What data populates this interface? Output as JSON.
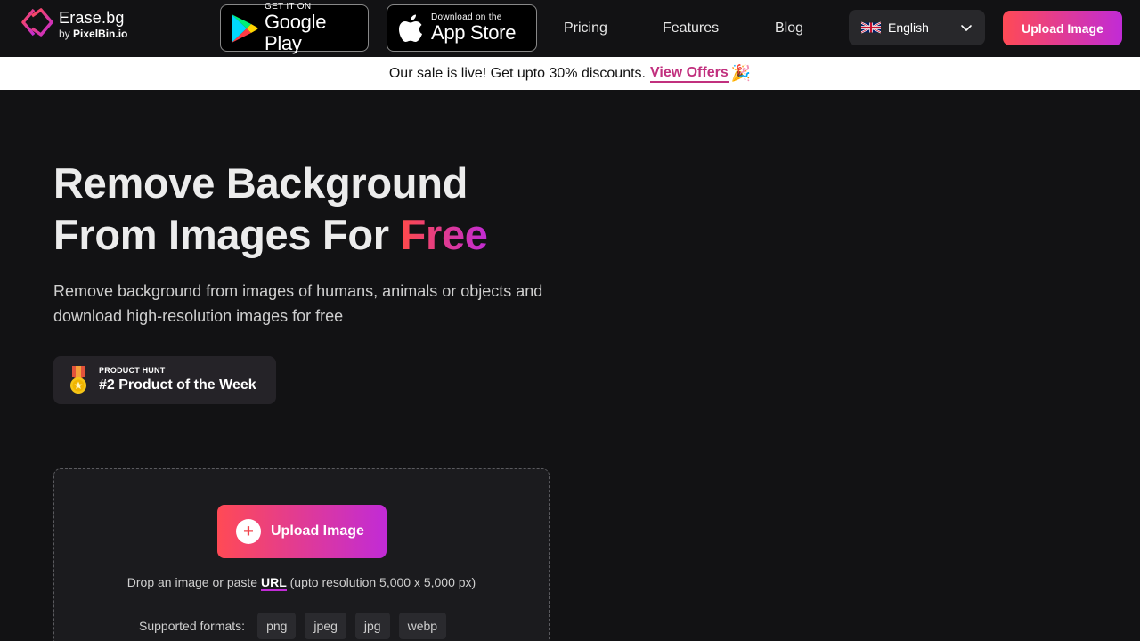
{
  "header": {
    "logo": {
      "name": "Erase.bg",
      "by_prefix": "by",
      "by_brand": "PixelBin.io"
    },
    "google_play": {
      "small": "GET IT ON",
      "big": "Google Play"
    },
    "app_store": {
      "small": "Download on the",
      "big": "App Store"
    },
    "nav": [
      "Pricing",
      "Features",
      "Blog"
    ],
    "language": {
      "selected": "English"
    },
    "upload_label": "Upload Image"
  },
  "banner": {
    "text": "Our sale is live! Get upto 30% discounts.",
    "link": "View Offers",
    "emoji": "🎉"
  },
  "hero": {
    "title_line1": "Remove Background",
    "title_line2_prefix": "From Images For ",
    "title_highlight": "Free",
    "subtitle": "Remove background from images of humans, animals or objects and download high-resolution images for free"
  },
  "badge": {
    "small": "PRODUCT HUNT",
    "big": "#2 Product of the Week"
  },
  "upload": {
    "button_label": "Upload Image",
    "drop_prefix": "Drop an image or paste ",
    "drop_link": "URL",
    "drop_suffix": " (upto resolution 5,000 x 5,000 px)",
    "formats_label": "Supported formats:",
    "formats": [
      "png",
      "jpeg",
      "jpg",
      "webp"
    ]
  },
  "colors": {
    "accent_start": "#ff4a55",
    "accent_end": "#c12bd6",
    "background": "#121214"
  }
}
